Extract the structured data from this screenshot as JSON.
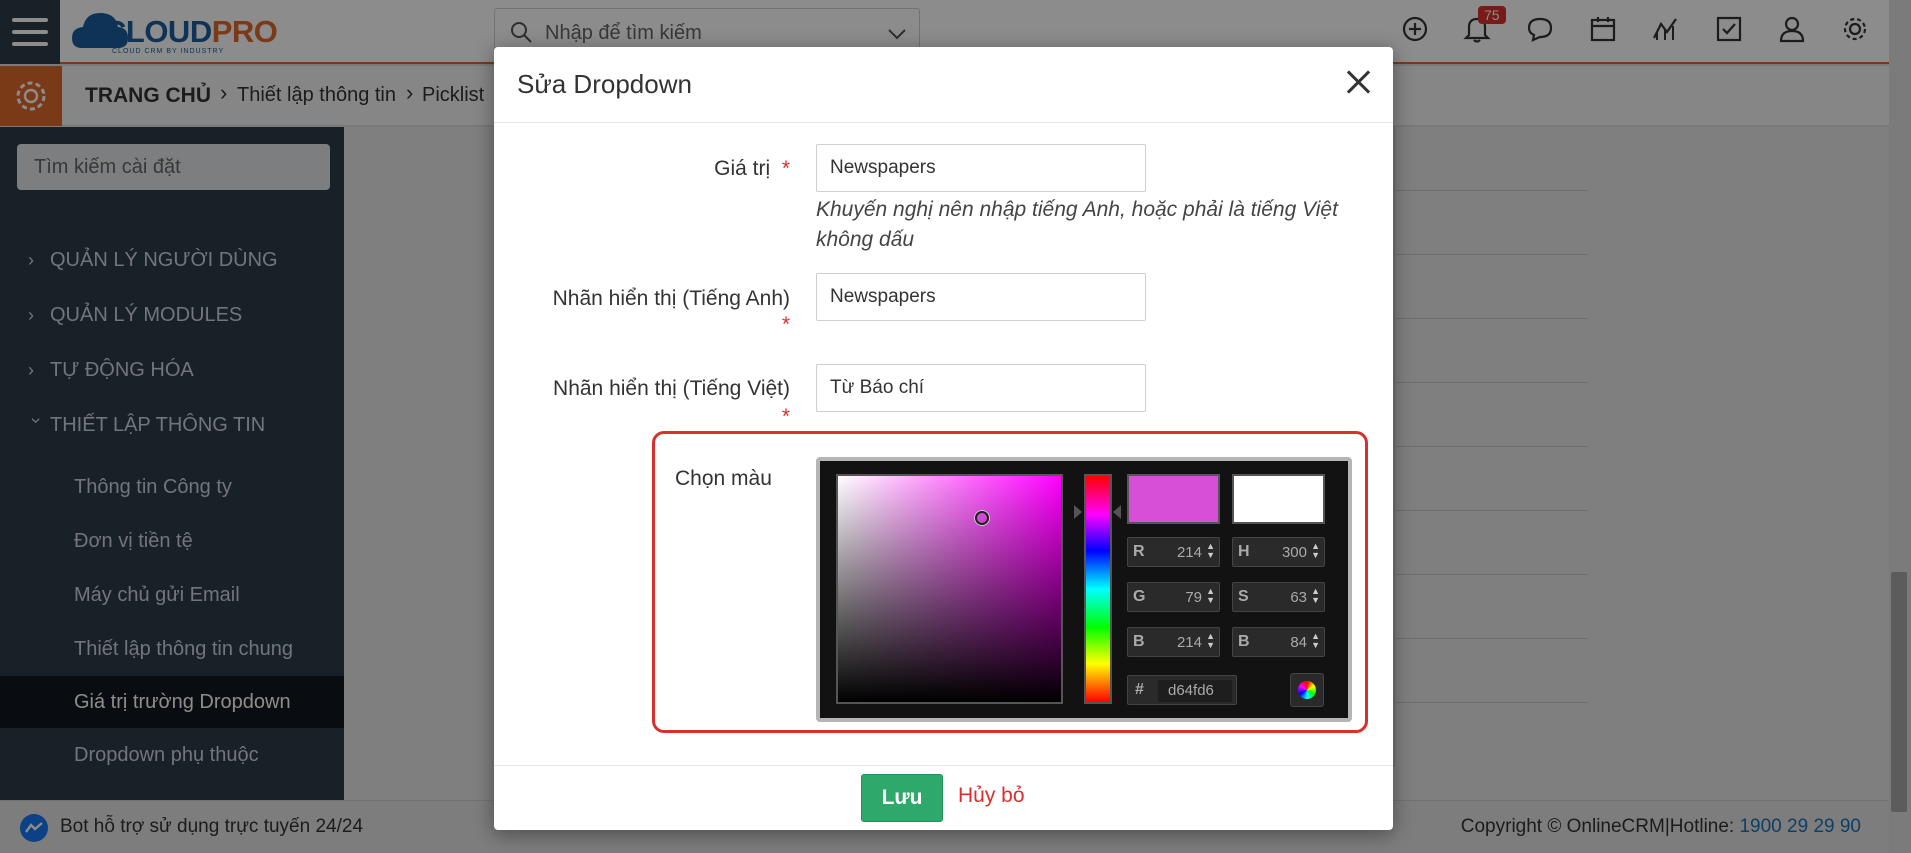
{
  "header": {
    "logo_main": "CLOUD",
    "logo_accent": "PRO",
    "logo_tagline": "CLOUD CRM BY INDUSTRY",
    "search_placeholder": "Nhập để tìm kiếm",
    "notification_count": "75",
    "icons": [
      "plus-circle-icon",
      "bell-icon",
      "chat-icon",
      "calendar-icon",
      "chart-icon",
      "checkbox-icon",
      "user-icon",
      "gear-icon"
    ]
  },
  "breadcrumb": {
    "home": "TRANG CHỦ",
    "level1": "Thiết lập thông tin",
    "level2": "Picklist"
  },
  "sidebar": {
    "search_placeholder": "Tìm kiếm cài đặt",
    "groups": [
      {
        "label": "QUẢN LÝ NGƯỜI DÙNG",
        "expanded": false
      },
      {
        "label": "QUẢN LÝ MODULES",
        "expanded": false
      },
      {
        "label": "TỰ ĐỘNG HÓA",
        "expanded": false
      },
      {
        "label": "THIẾT LẬP THÔNG TIN",
        "expanded": true
      }
    ],
    "items": [
      {
        "label": "Thông tin Công ty",
        "active": false
      },
      {
        "label": "Đơn vị tiền tệ",
        "active": false
      },
      {
        "label": "Máy chủ gửi Email",
        "active": false
      },
      {
        "label": "Thiết lập thông tin chung",
        "active": false
      },
      {
        "label": "Giá trị trường Dropdown",
        "active": true
      },
      {
        "label": "Dropdown phụ thuộc",
        "active": false
      }
    ]
  },
  "modal": {
    "title": "Sửa Dropdown",
    "fields": {
      "value_label": "Giá trị",
      "value": "Newspapers",
      "value_hint": "Khuyến nghị nên nhập tiếng Anh, hoặc phải là tiếng Việt không dấu",
      "label_en_label": "Nhãn hiển thị (Tiếng Anh)",
      "label_en": "Newspapers",
      "label_vi_label": "Nhãn hiển thị (Tiếng Việt)",
      "label_vi": "Từ Báo chí",
      "required_mark": "*",
      "color_label": "Chọn màu"
    },
    "color_picker": {
      "selected_color": "#d64fd6",
      "previous_color": "#ffffff",
      "hue_base": "#ff00ff",
      "r": "214",
      "g": "79",
      "b": "214",
      "h": "300",
      "s": "63",
      "v": "84",
      "r_label": "R",
      "g_label": "G",
      "b_label": "B",
      "h_label": "H",
      "s_label": "S",
      "v_label": "B",
      "hex_label": "#",
      "hex": "d64fd6"
    },
    "save_label": "Lưu",
    "cancel_label": "Hủy bỏ"
  },
  "footer": {
    "bot_text": "Bot hỗ trợ sử dụng trực tuyến 24/24",
    "copyright": "Copyright © OnlineCRM",
    "hotline_label": "Hotline:",
    "hotline": "1900 29 29 90"
  },
  "colors": {
    "accent_orange": "#e06b2a",
    "sidebar_bg": "#2c3b49",
    "brand_blue": "#1a5e9e",
    "save_green": "#2fa86b",
    "danger_red": "#d9302e"
  }
}
